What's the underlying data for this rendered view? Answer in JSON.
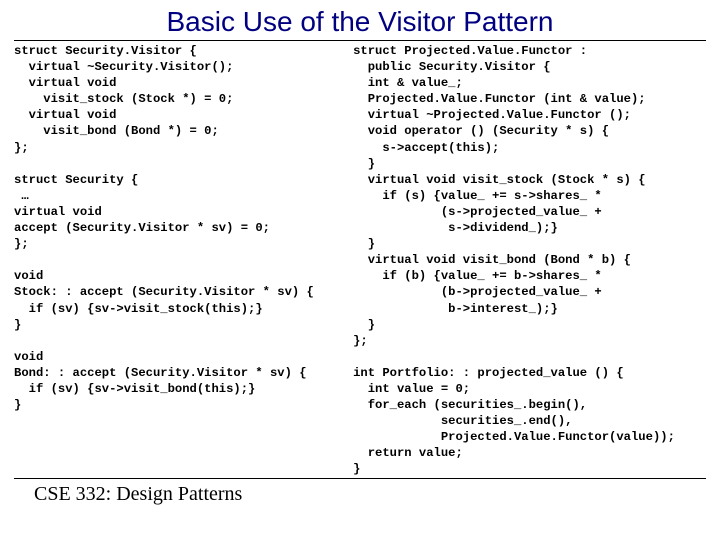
{
  "title": "Basic Use of the Visitor Pattern",
  "footer": "CSE 332: Design Patterns",
  "code_left": "struct Security.Visitor {\n  virtual ~Security.Visitor();\n  virtual void\n    visit_stock (Stock *) = 0;\n  virtual void\n    visit_bond (Bond *) = 0;\n};\n\nstruct Security {\n …\nvirtual void\naccept (Security.Visitor * sv) = 0;\n};\n\nvoid\nStock: : accept (Security.Visitor * sv) {\n  if (sv) {sv->visit_stock(this);}\n}\n\nvoid\nBond: : accept (Security.Visitor * sv) {\n  if (sv) {sv->visit_bond(this);}\n}",
  "code_right": "struct Projected.Value.Functor :\n  public Security.Visitor {\n  int & value_;\n  Projected.Value.Functor (int & value);\n  virtual ~Projected.Value.Functor ();\n  void operator () (Security * s) {\n    s->accept(this);\n  }\n  virtual void visit_stock (Stock * s) {\n    if (s) {value_ += s->shares_ *\n            (s->projected_value_ +\n             s->dividend_);}\n  }\n  virtual void visit_bond (Bond * b) {\n    if (b) {value_ += b->shares_ *\n            (b->projected_value_ +\n             b->interest_);}\n  }\n};\n\nint Portfolio: : projected_value () {\n  int value = 0;\n  for_each (securities_.begin(),\n            securities_.end(),\n            Projected.Value.Functor(value));\n  return value;\n}"
}
